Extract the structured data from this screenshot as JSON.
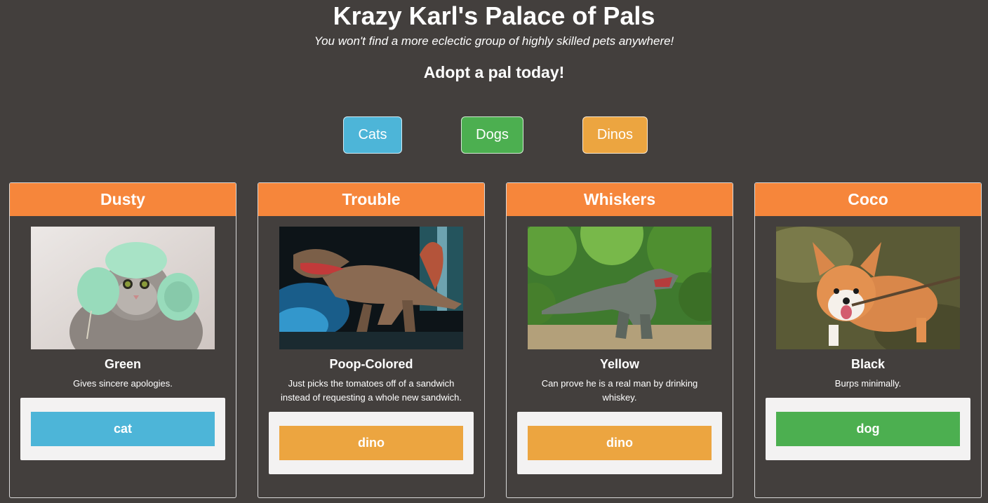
{
  "header": {
    "title": "Krazy Karl's Palace of Pals",
    "subtitle": "You won't find a more eclectic group of highly skilled pets anywhere!",
    "cta": "Adopt a pal today!"
  },
  "filters": [
    {
      "label": "Cats",
      "color": "#4db5d8"
    },
    {
      "label": "Dogs",
      "color": "#4caf50"
    },
    {
      "label": "Dinos",
      "color": "#eca540"
    }
  ],
  "colors": {
    "background": "#433f3d",
    "card_header": "#f6863b",
    "panel": "#f3f2f2",
    "cat": "#4db5d8",
    "dog": "#4caf50",
    "dino": "#eca540"
  },
  "pets": [
    {
      "name": "Dusty",
      "image": "cat-photo",
      "color": "Green",
      "description": "Gives sincere apologies.",
      "type": "cat"
    },
    {
      "name": "Trouble",
      "image": "dinosaur-photo",
      "color": "Poop-Colored",
      "description": "Just picks the tomatoes off of a sandwich instead of requesting a whole new sandwich.",
      "type": "dino"
    },
    {
      "name": "Whiskers",
      "image": "t-rex-photo",
      "color": "Yellow",
      "description": "Can prove he is a real man by drinking whiskey.",
      "type": "dino"
    },
    {
      "name": "Coco",
      "image": "corgi-photo",
      "color": "Black",
      "description": "Burps minimally.",
      "type": "dog"
    }
  ]
}
